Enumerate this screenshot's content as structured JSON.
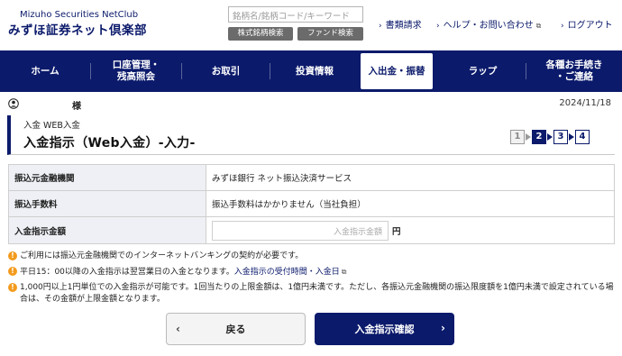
{
  "header": {
    "brand_en": "Mizuho Securities NetClub",
    "brand_jp": "みずほ証券ネット倶楽部",
    "search_placeholder": "銘柄名/銘柄コード/キーワード",
    "stock_search_label": "株式銘柄検索",
    "fund_search_label": "ファンド検索",
    "links": {
      "documents": "書類請求",
      "help": "ヘルプ・お問い合わせ",
      "logout": "ログアウト"
    }
  },
  "nav": {
    "home": "ホーム",
    "account_line1": "口座管理・",
    "account_line2": "残高照会",
    "trade": "お取引",
    "invest_info": "投資情報",
    "deposit": "入出金・振替",
    "wrap": "ラップ",
    "procedures_line1": "各種お手続き",
    "procedures_line2": "・ご連絡"
  },
  "user": {
    "sama": "様",
    "date": "2024/11/18"
  },
  "page": {
    "breadcrumb": "入金 WEB入金",
    "title": "入金指示（Web入金）-入力-"
  },
  "steps": [
    "1",
    "2",
    "3",
    "4"
  ],
  "form": {
    "bank_label": "振込元金融機関",
    "bank_value": "みずほ銀行 ネット振込決済サービス",
    "fee_label": "振込手数料",
    "fee_value": "振込手数料はかかりません（当社負担）",
    "amount_label": "入金指示金額",
    "amount_placeholder": "入金指示金額",
    "amount_value": "",
    "currency": "円"
  },
  "notes": {
    "n1": "ご利用には振込元金融機関でのインターネットバンキングの契約が必要です。",
    "n2_text": "平日15：00以降の入金指示は翌営業日の入金となります。",
    "n2_link": "入金指示の受付時間・入金日",
    "n3": "1,000円以上1円単位での入金指示が可能です。1回当たりの上限金額は、1億円未満です。ただし、各振込元金融機関の振込限度額を1億円未満で設定されている場合は、その金額が上限金額となります。"
  },
  "buttons": {
    "back": "戻る",
    "confirm": "入金指示確認"
  },
  "colors": {
    "brand_navy": "#0b1a6b",
    "warning_orange": "#f39b1d"
  }
}
